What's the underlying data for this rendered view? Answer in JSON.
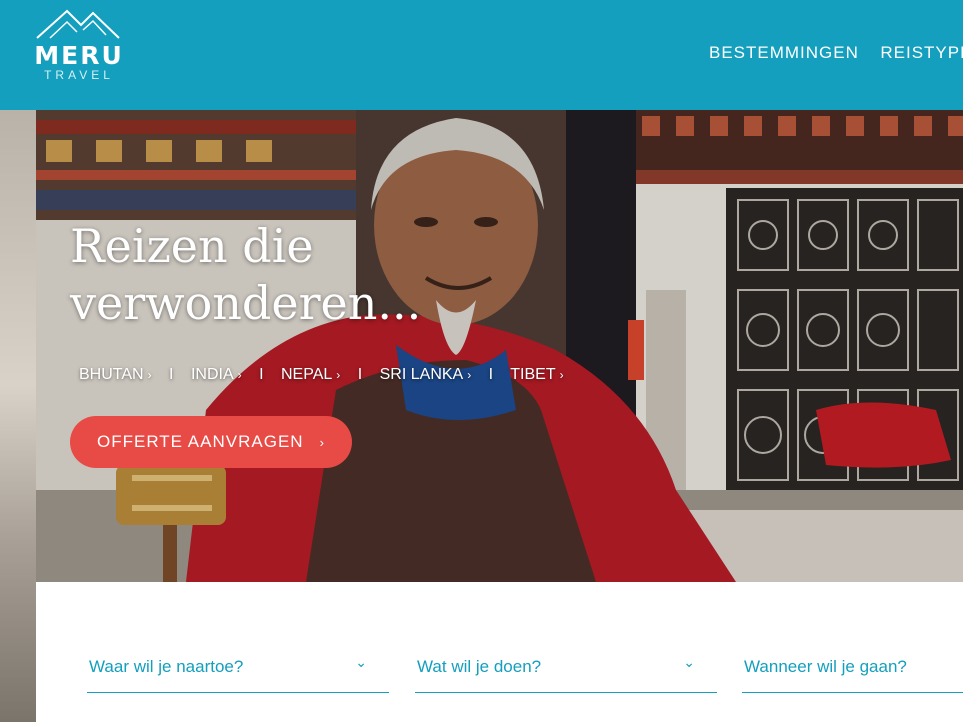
{
  "header": {
    "logo_name": "MERU",
    "logo_sub": "TRAVEL",
    "nav": [
      "BESTEMMINGEN",
      "REISTYPE"
    ],
    "background": "#139fbd"
  },
  "hero": {
    "title_line1": "Reizen die",
    "title_line2": "verwonderen...",
    "destinations": [
      "BHUTAN",
      "INDIA",
      "NEPAL",
      "SRI LANKA",
      "TIBET"
    ],
    "separator": "I",
    "link_chevron": "›",
    "cta_label": "OFFERTE AANVRAGEN",
    "cta_chevron": "›",
    "cta_color": "#e84a45"
  },
  "search": {
    "fields": [
      {
        "label": "Waar wil je naartoe?",
        "chevron": "⌄"
      },
      {
        "label": "Wat wil je doen?",
        "chevron": "⌄"
      },
      {
        "label": "Wanneer wil je gaan?",
        "chevron": ""
      }
    ],
    "accent": "#139fbd"
  }
}
